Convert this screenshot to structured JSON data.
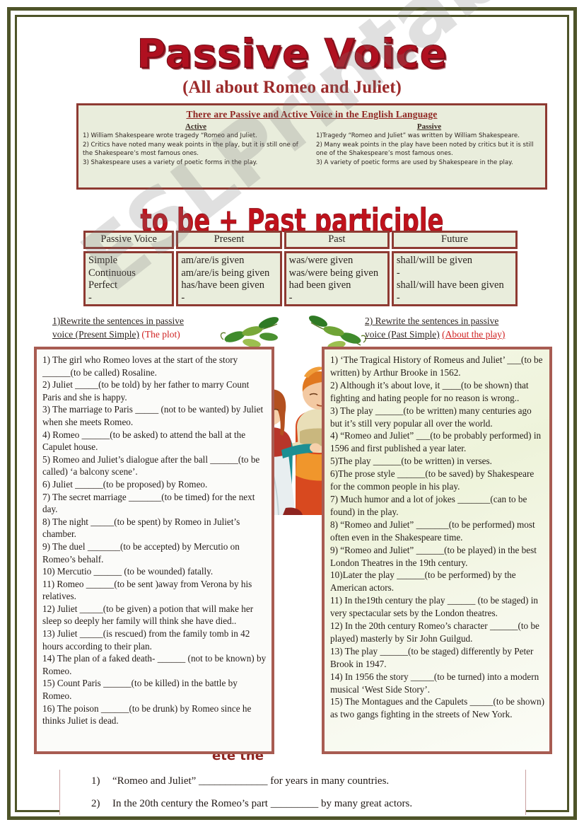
{
  "title": "Passive Voice",
  "subtitle": "(All about Romeo and Juliet)",
  "watermark": "ESLPrintables.com",
  "colors": {
    "frame": "#4e5429",
    "title_red": "#b01020",
    "box_border": "#8e3a32",
    "box_fill": "#e9eddc",
    "exercise_border": "#a85c52",
    "accent_red": "#cf2020"
  },
  "explain": {
    "heading": "There are Passive and Active Voice in the English Language",
    "active_header": "Active",
    "passive_header": "Passive",
    "active": [
      "1) William Shakespeare wrote tragedy “Romeo and Juliet.",
      "2) Critics have noted many weak points in the play, but it is still one of the  Shakespeare’s most famous ones.",
      "3) Shakespeare uses a variety of poetic forms in the play."
    ],
    "passive": [
      "1)Tragedy “Romeo and Juliet” was written by William Shakespeare.",
      "2) Many weak points in the play have been noted by critics but it is still one of the  Shakespeare’s most famous ones.",
      "3) A variety of poetic forms are used  by Shakespeare in the play."
    ]
  },
  "formula": "to be + Past participle",
  "tense_table": {
    "headers": [
      "Passive Voice",
      "Present",
      "Past",
      "Future"
    ],
    "rows_labels": [
      "Simple",
      "Continuous",
      "Perfect",
      "-"
    ],
    "present": [
      "am/are/is given",
      "am/are/is being given",
      "has/have been given",
      "-"
    ],
    "past": [
      "was/were given",
      "was/were being given",
      "had been given",
      "-"
    ],
    "future": [
      "shall/will be given",
      "-",
      "shall/will have been given",
      "-"
    ]
  },
  "instructions": {
    "left_line1": "1)Rewrite the sentences in passive",
    "left_line2": "voice (Present Simple)",
    "left_tag": "(The plot)",
    "right_line1": "2) Rewrite the sentences in passive",
    "right_line2": "voice  (Past Simple)",
    "right_tag": "(About the play)"
  },
  "exercise_left": [
    "1) The girl who Romeo loves at the start of the story ______(to be called) Rosaline.",
    "2) Juliet _____(to be told) by her father to marry Count Paris and she is happy.",
    "3) The marriage to Paris _____ (not to be wanted) by Juliet when she meets Romeo.",
    "4) Romeo ______(to be asked) to attend the ball at the Capulet house.",
    "5) Romeo and Juliet’s dialogue after the ball ______(to be called) ‘a balcony scene’.",
    "6) Juliet ______(to be proposed) by Romeo.",
    "7) The secret marriage _______(to be timed) for the next day.",
    "8) The night _____(to be spent) by Romeo in Juliet’s chamber.",
    "9) The duel _______(to be  accepted) by Mercutio on Romeo’s behalf.",
    "10) Mercutio ______ (to be wounded) fatally.",
    "11) Romeo ______(to be sent )away from Verona by his relatives.",
    "12) Juliet _____(to be given) a potion  that will make her sleep so deeply her family will think she have died..",
    "13) Juliet _____(is rescued) from the family tomb in 42 hours according to their plan.",
    "14) The plan of a faked  death- ______ (not to be known) by Romeo.",
    "15) Count Paris ______(to be killed) in the battle by Romeo.",
    "16) The poison ______(to be drunk) by Romeo since he thinks Juliet is dead."
  ],
  "exercise_right": [
    "1)  ‘The Tragical History of Romeus and Juliet’ ___(to be written) by Arthur Brooke in 1562.",
    "2) Although it’s about love, it ____(to be shown) that fighting and hating people for no reason is wrong..",
    "3) The play ______(to be written) many centuries ago but it’s still very popular all over the world.",
    "4) “Romeo and Juliet” ___(to be probably performed) in 1596 and first published a year later.",
    "5)The play ______(to be written) in verses.",
    "6)The prose style ______(to be  saved) by Shakespeare for the common people in his play.",
    "7) Much humor and a lot of jokes _______(can  to be found) in the play.",
    "8) “Romeo and Juliet” _______(to be performed) most often even in the Shakespeare time.",
    "9) “Romeo and Juliet” ______(to be played) in the best London Theatres in the 19th century.",
    "10)Later the play ______(to be performed) by the American actors.",
    "11) In the19th century the play ______ (to be staged) in very spectacular sets by the London theatres.",
    "12) In the 20th century Romeo’s character ______(to be played) masterly by  Sir John Guilgud.",
    "13) The play ______(to be staged) differently by Peter Brook in 1947.",
    "14)  In 1956 the story _____(to be turned) into a modern musical ‘West Side Story’.",
    "15) The Montagues and the Capulets _____(to be shown) as two gangs fighting in the streets of New York."
  ],
  "bottom": {
    "heading_fragment": "ete the",
    "items": [
      {
        "num": "1)",
        "text": "“Romeo and Juliet” _____________ for years in many countries."
      },
      {
        "num": "2)",
        "text": "In the 20th century the Romeo’s part _________  by many great actors."
      }
    ]
  }
}
